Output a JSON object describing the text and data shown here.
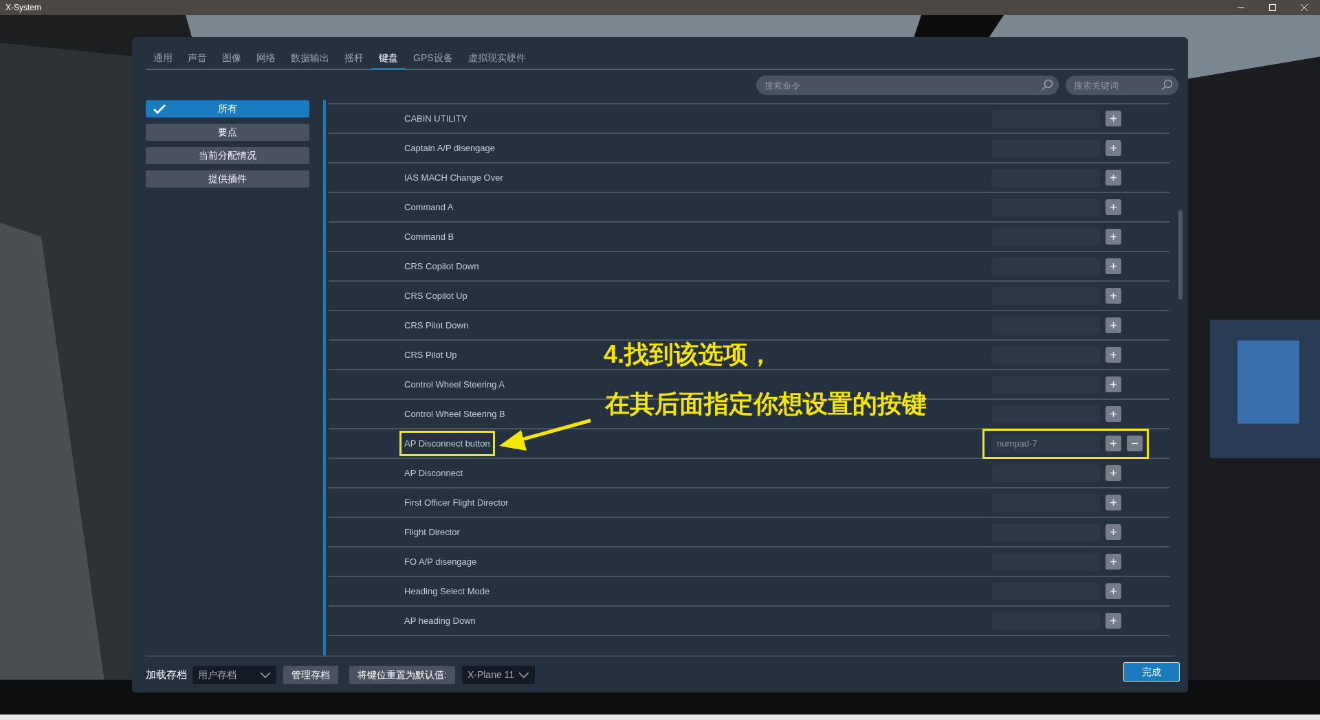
{
  "window": {
    "title": "X-System"
  },
  "tabs": [
    {
      "label": "通用",
      "selected": false
    },
    {
      "label": "声音",
      "selected": false
    },
    {
      "label": "图像",
      "selected": false
    },
    {
      "label": "网络",
      "selected": false
    },
    {
      "label": "数据输出",
      "selected": false
    },
    {
      "label": "摇杆",
      "selected": false
    },
    {
      "label": "键盘",
      "selected": true
    },
    {
      "label": "GPS设备",
      "selected": false
    },
    {
      "label": "虚拟现实硬件",
      "selected": false
    }
  ],
  "search_fields": [
    {
      "placeholder": "搜索命令"
    },
    {
      "placeholder": "搜索关键词"
    }
  ],
  "sidebar": {
    "items": [
      {
        "label": "所有",
        "selected": true
      },
      {
        "label": "要点",
        "selected": false
      },
      {
        "label": "当前分配情况",
        "selected": false
      },
      {
        "label": "提供插件",
        "selected": false
      }
    ]
  },
  "commands": [
    {
      "name": "CABIN UTILITY",
      "highlighted": false
    },
    {
      "name": "Captain A/P disengage",
      "highlighted": false
    },
    {
      "name": "IAS MACH Change Over",
      "highlighted": false
    },
    {
      "name": "Command A",
      "highlighted": false
    },
    {
      "name": "Command B",
      "highlighted": false
    },
    {
      "name": "CRS Copilot Down",
      "highlighted": false
    },
    {
      "name": "CRS Copilot Up",
      "highlighted": false
    },
    {
      "name": "CRS Pilot Down",
      "highlighted": false
    },
    {
      "name": "CRS Pilot Up",
      "highlighted": false
    },
    {
      "name": "Control Wheel Steering A",
      "highlighted": false
    },
    {
      "name": "Control Wheel Steering B",
      "highlighted": false
    },
    {
      "name": "AP Disconnect button",
      "binding": "numpad-7",
      "highlighted": true
    },
    {
      "name": "AP Disconnect",
      "highlighted": false
    },
    {
      "name": "First Officer Flight Director",
      "highlighted": false
    },
    {
      "name": "Flight Director",
      "highlighted": false
    },
    {
      "name": "FO A/P disengage",
      "highlighted": false
    },
    {
      "name": "Heading Select Mode",
      "highlighted": false
    },
    {
      "name": "AP heading Down",
      "highlighted": false
    }
  ],
  "annotation": {
    "lines": [
      "4.找到该选项，",
      "在其后面指定你想设置的按键"
    ]
  },
  "footer": {
    "profile_label": "加载存档",
    "profile_select": "用户存档",
    "manage_button": "管理存档",
    "reset_label": "将键位重置为默认值:",
    "reset_select": "X-Plane 11",
    "done_button": "完成"
  }
}
